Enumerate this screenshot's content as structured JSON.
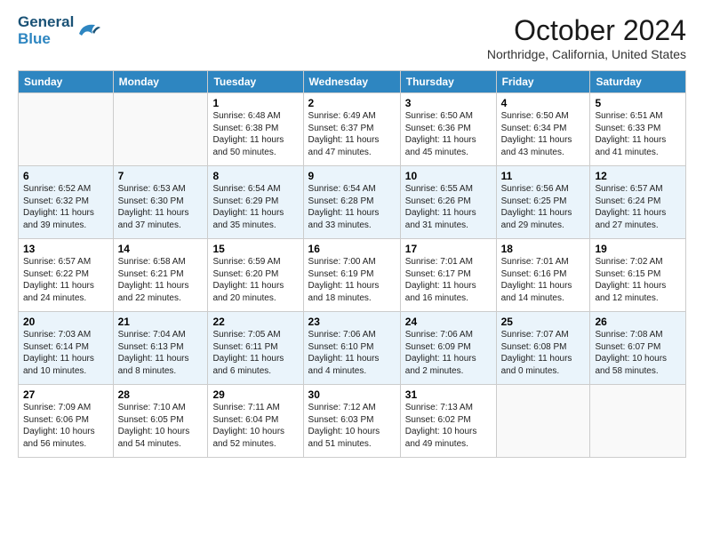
{
  "logo": {
    "line1": "General",
    "line2": "Blue"
  },
  "title": "October 2024",
  "subtitle": "Northridge, California, United States",
  "weekdays": [
    "Sunday",
    "Monday",
    "Tuesday",
    "Wednesday",
    "Thursday",
    "Friday",
    "Saturday"
  ],
  "weeks": [
    [
      {
        "day": "",
        "info": ""
      },
      {
        "day": "",
        "info": ""
      },
      {
        "day": "1",
        "info": "Sunrise: 6:48 AM\nSunset: 6:38 PM\nDaylight: 11 hours\nand 50 minutes."
      },
      {
        "day": "2",
        "info": "Sunrise: 6:49 AM\nSunset: 6:37 PM\nDaylight: 11 hours\nand 47 minutes."
      },
      {
        "day": "3",
        "info": "Sunrise: 6:50 AM\nSunset: 6:36 PM\nDaylight: 11 hours\nand 45 minutes."
      },
      {
        "day": "4",
        "info": "Sunrise: 6:50 AM\nSunset: 6:34 PM\nDaylight: 11 hours\nand 43 minutes."
      },
      {
        "day": "5",
        "info": "Sunrise: 6:51 AM\nSunset: 6:33 PM\nDaylight: 11 hours\nand 41 minutes."
      }
    ],
    [
      {
        "day": "6",
        "info": "Sunrise: 6:52 AM\nSunset: 6:32 PM\nDaylight: 11 hours\nand 39 minutes."
      },
      {
        "day": "7",
        "info": "Sunrise: 6:53 AM\nSunset: 6:30 PM\nDaylight: 11 hours\nand 37 minutes."
      },
      {
        "day": "8",
        "info": "Sunrise: 6:54 AM\nSunset: 6:29 PM\nDaylight: 11 hours\nand 35 minutes."
      },
      {
        "day": "9",
        "info": "Sunrise: 6:54 AM\nSunset: 6:28 PM\nDaylight: 11 hours\nand 33 minutes."
      },
      {
        "day": "10",
        "info": "Sunrise: 6:55 AM\nSunset: 6:26 PM\nDaylight: 11 hours\nand 31 minutes."
      },
      {
        "day": "11",
        "info": "Sunrise: 6:56 AM\nSunset: 6:25 PM\nDaylight: 11 hours\nand 29 minutes."
      },
      {
        "day": "12",
        "info": "Sunrise: 6:57 AM\nSunset: 6:24 PM\nDaylight: 11 hours\nand 27 minutes."
      }
    ],
    [
      {
        "day": "13",
        "info": "Sunrise: 6:57 AM\nSunset: 6:22 PM\nDaylight: 11 hours\nand 24 minutes."
      },
      {
        "day": "14",
        "info": "Sunrise: 6:58 AM\nSunset: 6:21 PM\nDaylight: 11 hours\nand 22 minutes."
      },
      {
        "day": "15",
        "info": "Sunrise: 6:59 AM\nSunset: 6:20 PM\nDaylight: 11 hours\nand 20 minutes."
      },
      {
        "day": "16",
        "info": "Sunrise: 7:00 AM\nSunset: 6:19 PM\nDaylight: 11 hours\nand 18 minutes."
      },
      {
        "day": "17",
        "info": "Sunrise: 7:01 AM\nSunset: 6:17 PM\nDaylight: 11 hours\nand 16 minutes."
      },
      {
        "day": "18",
        "info": "Sunrise: 7:01 AM\nSunset: 6:16 PM\nDaylight: 11 hours\nand 14 minutes."
      },
      {
        "day": "19",
        "info": "Sunrise: 7:02 AM\nSunset: 6:15 PM\nDaylight: 11 hours\nand 12 minutes."
      }
    ],
    [
      {
        "day": "20",
        "info": "Sunrise: 7:03 AM\nSunset: 6:14 PM\nDaylight: 11 hours\nand 10 minutes."
      },
      {
        "day": "21",
        "info": "Sunrise: 7:04 AM\nSunset: 6:13 PM\nDaylight: 11 hours\nand 8 minutes."
      },
      {
        "day": "22",
        "info": "Sunrise: 7:05 AM\nSunset: 6:11 PM\nDaylight: 11 hours\nand 6 minutes."
      },
      {
        "day": "23",
        "info": "Sunrise: 7:06 AM\nSunset: 6:10 PM\nDaylight: 11 hours\nand 4 minutes."
      },
      {
        "day": "24",
        "info": "Sunrise: 7:06 AM\nSunset: 6:09 PM\nDaylight: 11 hours\nand 2 minutes."
      },
      {
        "day": "25",
        "info": "Sunrise: 7:07 AM\nSunset: 6:08 PM\nDaylight: 11 hours\nand 0 minutes."
      },
      {
        "day": "26",
        "info": "Sunrise: 7:08 AM\nSunset: 6:07 PM\nDaylight: 10 hours\nand 58 minutes."
      }
    ],
    [
      {
        "day": "27",
        "info": "Sunrise: 7:09 AM\nSunset: 6:06 PM\nDaylight: 10 hours\nand 56 minutes."
      },
      {
        "day": "28",
        "info": "Sunrise: 7:10 AM\nSunset: 6:05 PM\nDaylight: 10 hours\nand 54 minutes."
      },
      {
        "day": "29",
        "info": "Sunrise: 7:11 AM\nSunset: 6:04 PM\nDaylight: 10 hours\nand 52 minutes."
      },
      {
        "day": "30",
        "info": "Sunrise: 7:12 AM\nSunset: 6:03 PM\nDaylight: 10 hours\nand 51 minutes."
      },
      {
        "day": "31",
        "info": "Sunrise: 7:13 AM\nSunset: 6:02 PM\nDaylight: 10 hours\nand 49 minutes."
      },
      {
        "day": "",
        "info": ""
      },
      {
        "day": "",
        "info": ""
      }
    ]
  ]
}
